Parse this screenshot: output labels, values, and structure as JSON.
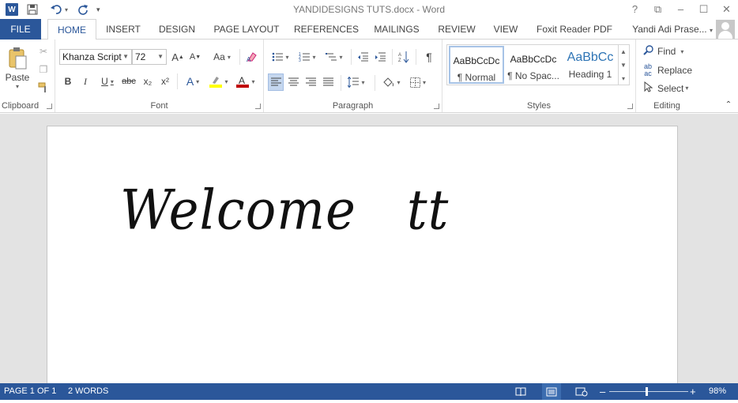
{
  "window": {
    "title": "YANDIDESIGNS TUTS.docx - Word",
    "app_icon": "W",
    "controls": [
      "?",
      "⧉",
      "–",
      "☐",
      "✕"
    ]
  },
  "quick_access": {
    "save_icon": "save-icon",
    "undo_icon": "undo-icon",
    "redo_icon": "repeat-icon"
  },
  "tabs": [
    "FILE",
    "HOME",
    "INSERT",
    "DESIGN",
    "PAGE LAYOUT",
    "REFERENCES",
    "MAILINGS",
    "REVIEW",
    "VIEW",
    "Foxit Reader PDF"
  ],
  "user": {
    "name": "Yandi Adi Prase..."
  },
  "ribbon": {
    "clipboard": {
      "label": "Clipboard",
      "paste": "Paste"
    },
    "font": {
      "label": "Font",
      "family": "Khanza Script",
      "size": "72",
      "bold": "B",
      "italic": "I",
      "underline": "U",
      "strike": "abc",
      "sub": "x₂",
      "sup": "x²",
      "grow": "A",
      "shrink": "A",
      "case": "Aa"
    },
    "paragraph": {
      "label": "Paragraph",
      "pilcrow": "¶"
    },
    "styles": {
      "label": "Styles",
      "items": [
        {
          "preview": "AaBbCcDc",
          "name": "¶ Normal"
        },
        {
          "preview": "AaBbCcDc",
          "name": "¶ No Spac..."
        },
        {
          "preview": "AaBbCc",
          "name": "Heading 1"
        }
      ]
    },
    "editing": {
      "label": "Editing",
      "find": "Find",
      "replace": "Replace",
      "select": "Select"
    }
  },
  "document": {
    "text": "Welcome   tt"
  },
  "status": {
    "page": "PAGE 1 OF 1",
    "words": "2 WORDS",
    "zoom": "98%",
    "zoom_minus": "–",
    "zoom_plus": "+"
  },
  "colors": {
    "accent": "#2b579a",
    "highlight": "#ffff00",
    "font_color": "#c00000"
  }
}
